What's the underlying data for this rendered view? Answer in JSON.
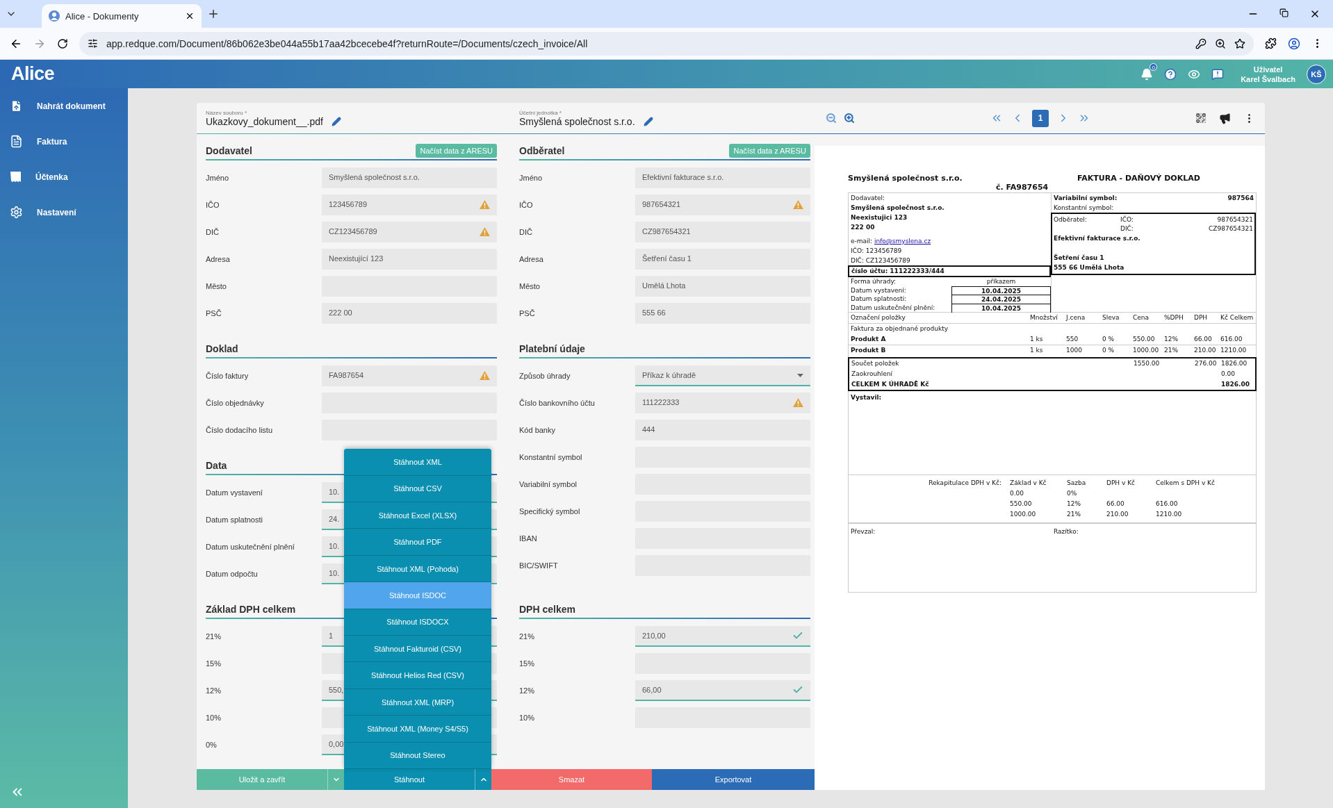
{
  "browser": {
    "tab_title": "Alice - Dokumenty",
    "url": "app.redque.com/Document/86b062e3be044a55b17aa42bcecebe4f?returnRoute=/Documents/czech_invoice/All"
  },
  "header": {
    "logo": "Alice",
    "notification_count": "0",
    "user_role": "Uživatel",
    "user_name": "Karel Švalbach",
    "avatar": "KŠ"
  },
  "sidebar": {
    "items": [
      {
        "label": "Nahrát dokument"
      },
      {
        "label": "Faktura"
      },
      {
        "label": "Účtenka"
      },
      {
        "label": "Nastavení"
      }
    ]
  },
  "document_fields": [
    {
      "label": "Název souboru *",
      "value": "Ukazkovy_dokument__.pdf"
    },
    {
      "label": "Účetní jednotka *",
      "value": "Smyšlená společnost s.r.o."
    }
  ],
  "form_blocks": [
    {
      "columns": [
        [
          {
            "title": "Dodavatel",
            "button": "Načíst data z ARESU",
            "fields": [
              {
                "label": "Jméno",
                "value": "Smyšlená společnost s.r.o."
              },
              {
                "label": "IČO",
                "value": "123456789",
                "warning": true
              },
              {
                "label": "DIČ",
                "value": "CZ123456789",
                "warning": true
              },
              {
                "label": "Adresa",
                "value": "Neexistující 123"
              },
              {
                "label": "Město"
              },
              {
                "label": "PSČ",
                "value": "222 00"
              }
            ]
          }
        ],
        [
          {
            "title": "Odběratel",
            "button": "Načíst data z ARESU",
            "fields": [
              {
                "label": "Jméno",
                "value": "Efektivní fakturace s.r.o."
              },
              {
                "label": "IČO",
                "value": "987654321",
                "warning": true
              },
              {
                "label": "DIČ",
                "value": "CZ987654321"
              },
              {
                "label": "Adresa",
                "value": "Šetření času 1"
              },
              {
                "label": "Město",
                "value": "Umělá Lhota"
              },
              {
                "label": "PSČ",
                "value": "555 66"
              }
            ]
          }
        ]
      ]
    },
    {
      "columns": [
        [
          {
            "title": "Doklad",
            "fields": [
              {
                "label": "Číslo faktury",
                "value": "FA987654",
                "warning": true
              },
              {
                "label": "Číslo objednávky"
              },
              {
                "label": "Číslo dodacího listu"
              }
            ]
          },
          {
            "title": "Data",
            "fields": [
              {
                "label": "Datum vystavení",
                "value": "10.",
                "valid": true
              },
              {
                "label": "Datum splatnosti",
                "value": "24.",
                "valid": true
              },
              {
                "label": "Datum uskutečnění plnění",
                "value": "10.",
                "valid": true
              },
              {
                "label": "Datum odpočtu",
                "value": "10.",
                "valid": true
              }
            ]
          }
        ],
        [
          {
            "title": "Platební údaje",
            "fields": [
              {
                "label": "Způsob úhrady",
                "value": "Příkaz k úhradě",
                "valid": true,
                "kind": "select"
              },
              {
                "label": "Číslo bankovního účtu",
                "value": "111222333",
                "warning": true
              },
              {
                "label": "Kód banky",
                "value": "444"
              },
              {
                "label": "Konstantní symbol"
              },
              {
                "label": "Variabilní symbol"
              },
              {
                "label": "Specifický symbol"
              },
              {
                "label": "IBAN"
              },
              {
                "label": "BIC/SWIFT"
              }
            ]
          }
        ]
      ]
    },
    {
      "columns": [
        [
          {
            "title": "Základ DPH celkem",
            "fields": [
              {
                "label": "21%",
                "value": "1",
                "valid": true
              },
              {
                "label": "15%"
              },
              {
                "label": "12%",
                "value": "550,",
                "valid": true
              },
              {
                "label": "10%"
              },
              {
                "label": "0%",
                "value": "0,00",
                "valid": true
              }
            ]
          }
        ],
        [
          {
            "title": "DPH celkem",
            "fields": [
              {
                "label": "21%",
                "value": "210,00",
                "checked": true
              },
              {
                "label": "15%"
              },
              {
                "label": "12%",
                "value": "66,00",
                "checked": true
              },
              {
                "label": "10%"
              }
            ]
          }
        ]
      ]
    }
  ],
  "actions": [
    {
      "label": "Uložit a zavřít",
      "kind": "save",
      "expanded": false
    },
    {
      "label": "Stáhnout",
      "kind": "download",
      "expanded": true
    },
    {
      "label": "Smazat",
      "kind": "delete"
    },
    {
      "label": "Exportovat",
      "kind": "export"
    }
  ],
  "download_menu": [
    {
      "label": "Stáhnout XML",
      "selected": false
    },
    {
      "label": "Stáhnout CSV",
      "selected": false
    },
    {
      "label": "Stáhnout Excel (XLSX)",
      "selected": false
    },
    {
      "label": "Stáhnout PDF",
      "selected": false
    },
    {
      "label": "Stáhnout XML (Pohoda)",
      "selected": false
    },
    {
      "label": "Stáhnout ISDOC",
      "selected": true
    },
    {
      "label": "Stáhnout ISDOCX",
      "selected": false
    },
    {
      "label": "Stáhnout Fakturoid (CSV)",
      "selected": false
    },
    {
      "label": "Stáhnout Helios Red (CSV)",
      "selected": false
    },
    {
      "label": "Stáhnout XML (MRP)",
      "selected": false
    },
    {
      "label": "Stáhnout XML (Money S4/S5)",
      "selected": false
    },
    {
      "label": "Stáhnout Stereo",
      "selected": false
    }
  ],
  "viewer": {
    "pages": [
      {
        "label": "1",
        "selected": true
      }
    ]
  },
  "invoice": {
    "company": "Smyšlená společnost s.r.o.",
    "title": "FAKTURA - DAŇOVÝ DOKLAD",
    "number": "č. FA987654",
    "supplier": {
      "label": "Dodavatel:",
      "name": "Smyšlená společnost s.r.o.",
      "street": "Neexistujici  123",
      "zip": "222 00",
      "email_label": "e-mail:",
      "email": "info@smyslena.cz",
      "ico": "IČO: 123456789",
      "dic": "DIČ: CZ123456789"
    },
    "account": "číslo účtu: 111222333/444",
    "payment": [
      {
        "label": "Forma úhrady:",
        "value": "příkazem",
        "kind": "plain"
      },
      {
        "label": "Datum vystavení:",
        "value": "10.04.2025",
        "kind": "boxed"
      },
      {
        "label": "Datum splatnosti:",
        "value": "24.04.2025",
        "kind": "boxed"
      },
      {
        "label": "Datum uskutečnění plnění:",
        "value": "10.04.2025",
        "kind": "boxed"
      }
    ],
    "symbols": [
      {
        "label": "Variabilní symbol:",
        "value": "987564",
        "kind": "bold"
      },
      {
        "label": "Konstantní symbol:",
        "kind": "plain"
      }
    ],
    "customer": {
      "label": "Odběratel:",
      "ico_label": "IČO:",
      "ico": "987654321",
      "dic_label": "DIČ:",
      "dic": "CZ987654321",
      "name": "Efektivní fakturace s.r.o.",
      "street": "Šetření času 1",
      "city": "555 66 Umělá Lhota"
    },
    "item_columns": [
      "Označení položky",
      "Množství",
      "J.cena",
      "Sleva",
      "Cena",
      "%DPH",
      "DPH",
      "Kč Celkem"
    ],
    "item_note": "Faktura za objednané produkty",
    "items": [
      [
        "Produkt A",
        "1 ks",
        "550",
        "0 %",
        "550.00",
        "12%",
        "66.00",
        "616.00"
      ],
      [
        "Produkt B",
        "1 ks",
        "1000",
        "0 %",
        "1000.00",
        "21%",
        "210.00",
        "1210.00"
      ]
    ],
    "totals": [
      {
        "label": "Součet položek",
        "price": "1550.00",
        "vat": "276.00",
        "total": "1826.00",
        "kind": "sum"
      },
      {
        "label": "Zaokrouhlení",
        "total": "0.00",
        "kind": "sum"
      },
      {
        "label": "CELKEM K ÚHRADĚ Kč",
        "total": "1826.00",
        "kind": "grand"
      }
    ],
    "issued_by": "Vystavil:",
    "recap_label": "Rekapitulace DPH v Kč:",
    "recap_columns": [
      "Základ v Kč",
      "Sazba",
      "DPH v Kč",
      "Celkem s DPH v Kč"
    ],
    "recap_rows": [
      [
        "0.00",
        "0%"
      ],
      [
        "550.00",
        "12%",
        "66.00",
        "616.00"
      ],
      [
        "1000.00",
        "21%",
        "210.00",
        "1210.00"
      ]
    ],
    "received_by": "Převzal:",
    "stamp": "Razítko:"
  }
}
